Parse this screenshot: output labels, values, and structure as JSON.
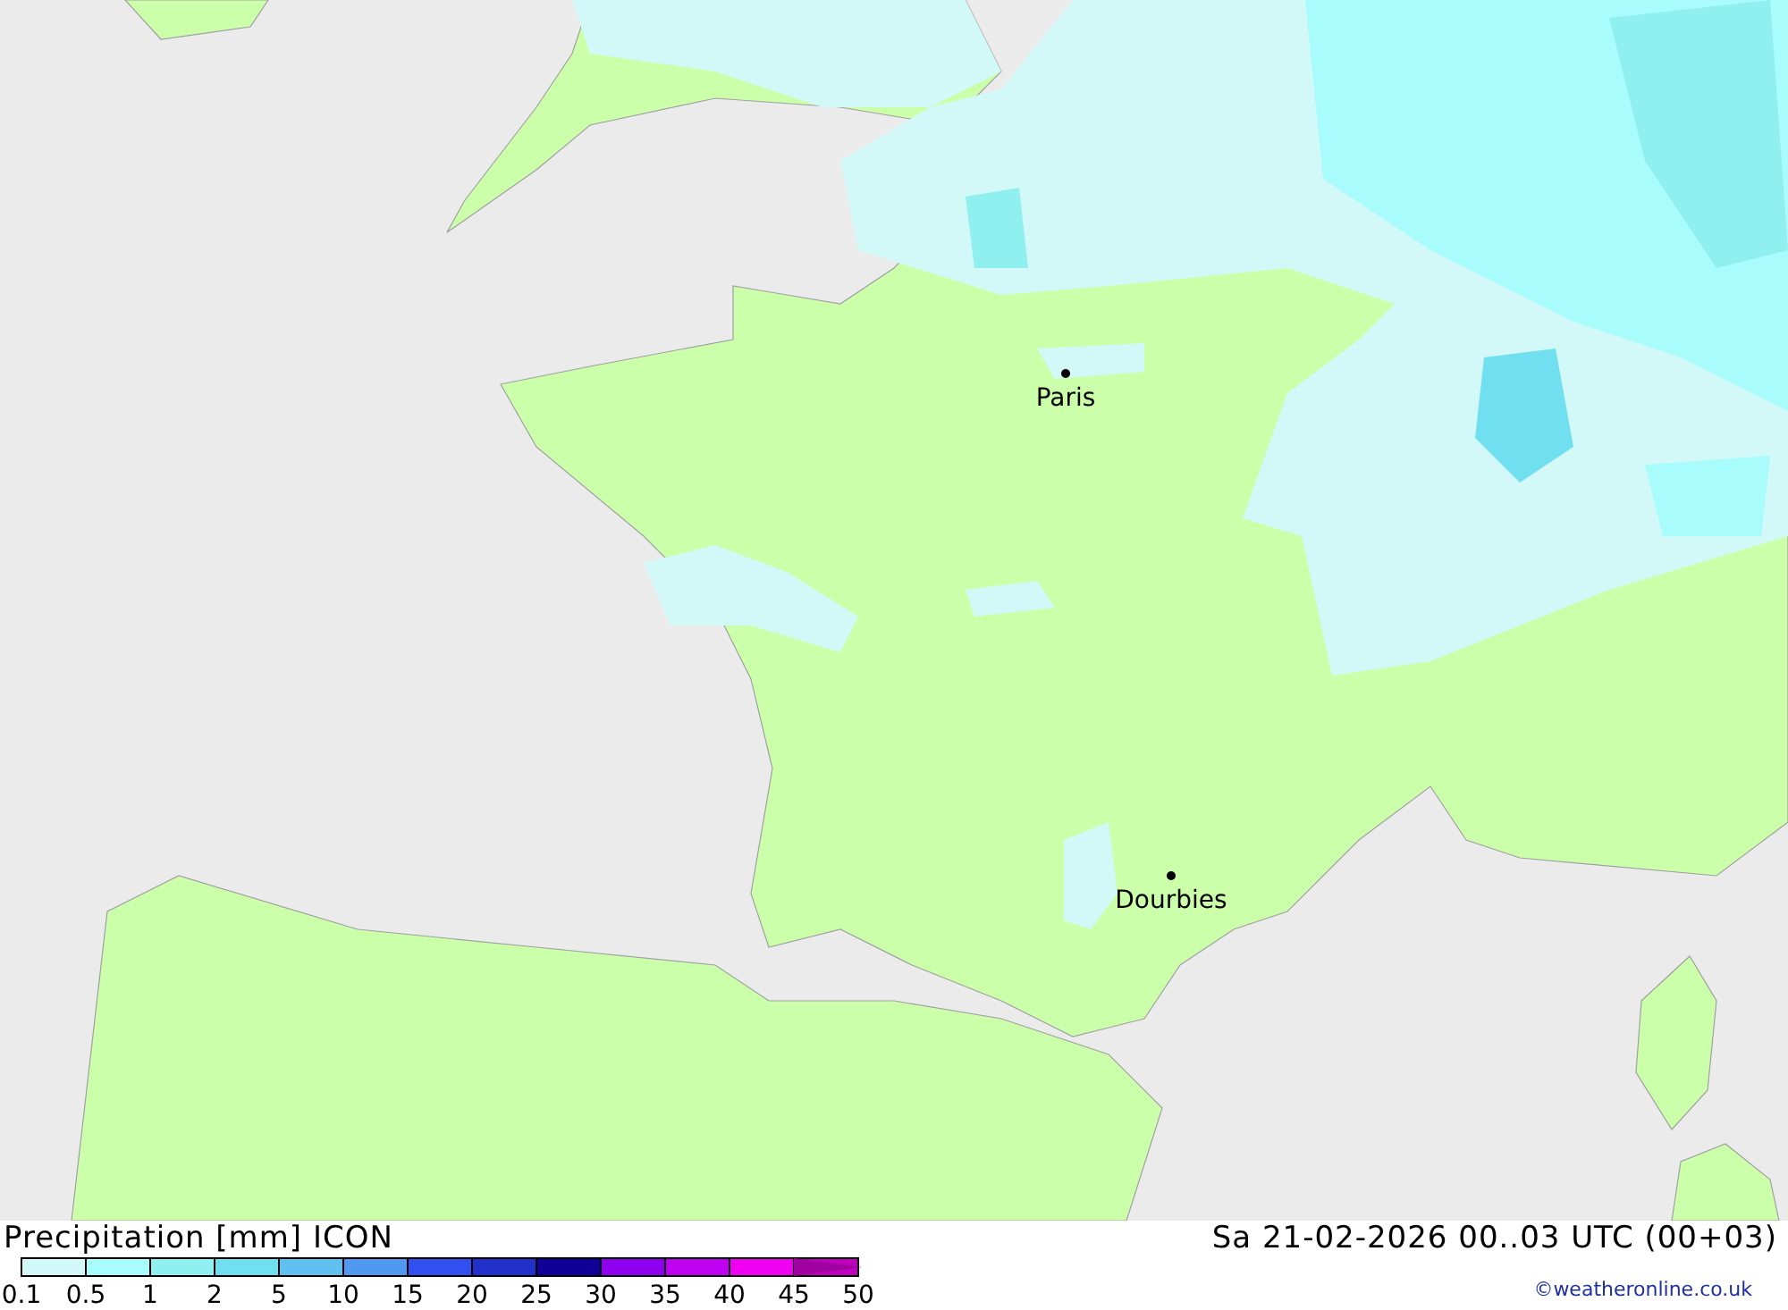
{
  "map": {
    "cities": [
      {
        "name": "Paris"
      },
      {
        "name": "Dourbies"
      }
    ]
  },
  "legend": {
    "title": "Precipitation [mm] ICON",
    "steps": [
      {
        "label": "0.1",
        "color": "#d2f8f8"
      },
      {
        "label": "0.5",
        "color": "#a8fcfc"
      },
      {
        "label": "1",
        "color": "#90f0f0"
      },
      {
        "label": "2",
        "color": "#70e0f0"
      },
      {
        "label": "5",
        "color": "#60c0f0"
      },
      {
        "label": "10",
        "color": "#5098f0"
      },
      {
        "label": "15",
        "color": "#3050f0"
      },
      {
        "label": "20",
        "color": "#2030c8"
      },
      {
        "label": "25",
        "color": "#100098"
      },
      {
        "label": "30",
        "color": "#9000f0"
      },
      {
        "label": "35",
        "color": "#c000f0"
      },
      {
        "label": "40",
        "color": "#f000f0"
      },
      {
        "label": "45",
        "color": "#c000c0"
      },
      {
        "label": "50",
        "color": "#a000a0"
      }
    ]
  },
  "valid_time": "Sa 21-02-2026 00..03 UTC (00+03)",
  "credit": "©weatheronline.co.uk"
}
